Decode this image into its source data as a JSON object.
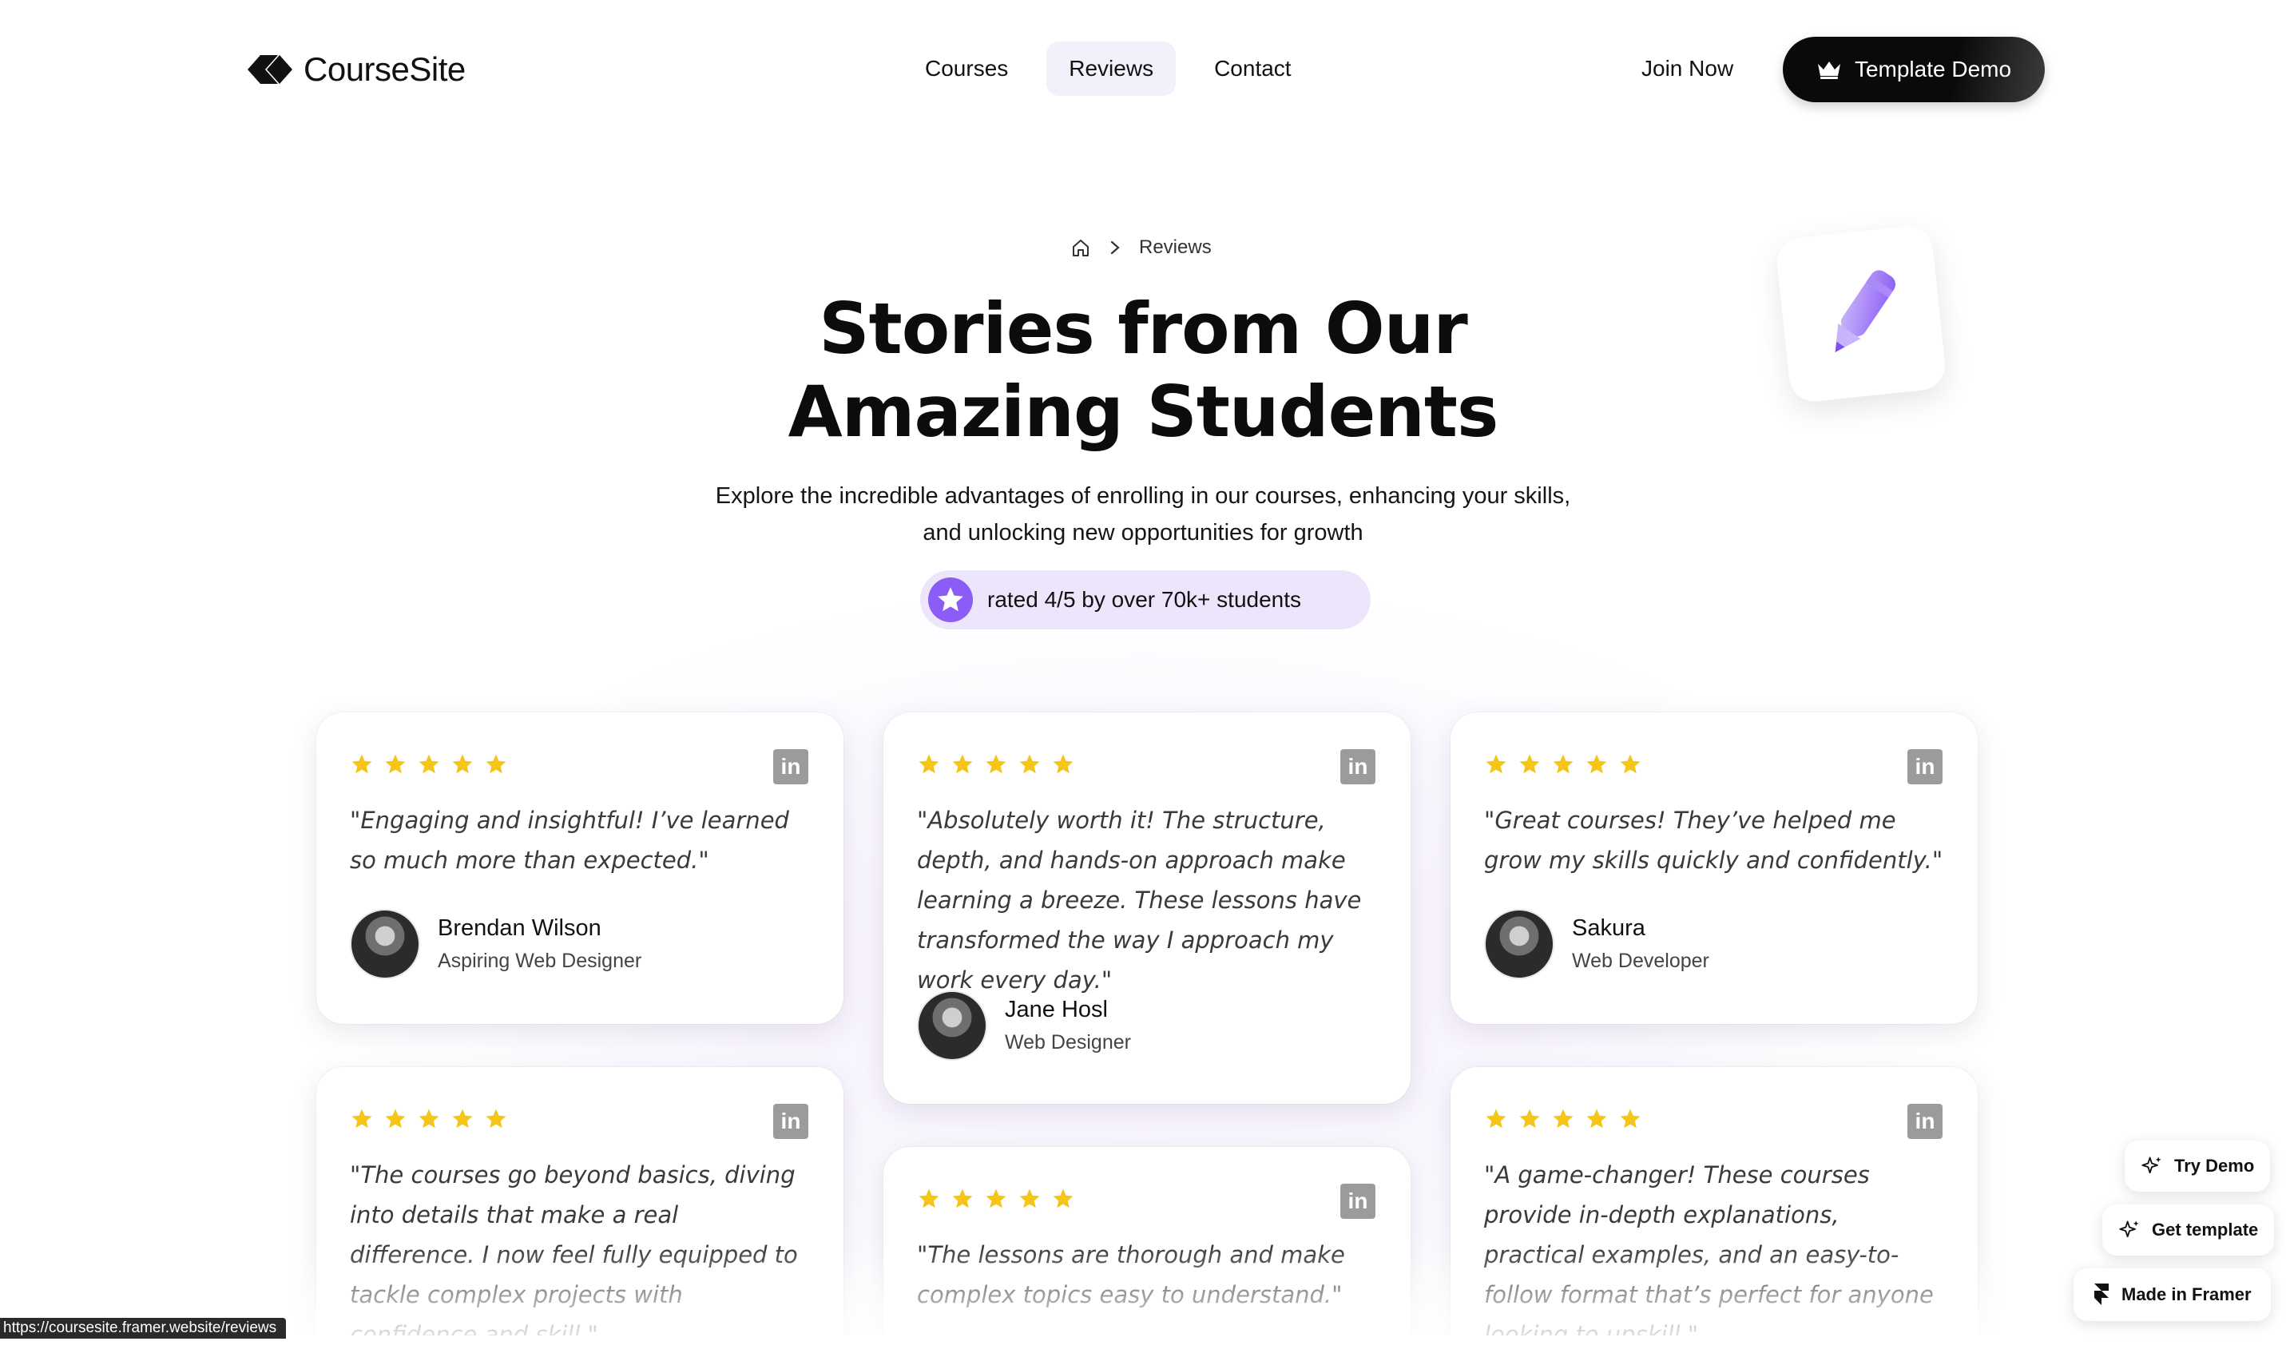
{
  "nav": {
    "brand": "CourseSite",
    "links": [
      {
        "label": "Courses",
        "active": false
      },
      {
        "label": "Reviews",
        "active": true
      },
      {
        "label": "Contact",
        "active": false
      }
    ],
    "join_label": "Join Now",
    "demo_label": "Template Demo"
  },
  "hero": {
    "breadcrumb_current": "Reviews",
    "title_line1": "Stories from Our",
    "title_line2": "Amazing Students",
    "subtitle_line1": "Explore the incredible advantages of enrolling in our courses, enhancing your skills,",
    "subtitle_line2": "and unlocking new opportunities for growth",
    "rating_text": "rated 4/5 by over 70k+ students"
  },
  "colors": {
    "accent": "#8b5cf6",
    "star": "#f5c518",
    "pill_bg": "#ece5fb"
  },
  "reviews": [
    {
      "rating": 5,
      "quote": "\"Engaging and insightful! I’ve learned so much more than expected.\"",
      "name": "Brendan Wilson",
      "role": "Aspiring Web Designer"
    },
    {
      "rating": 5,
      "quote": "\"Absolutely worth it! The structure, depth, and hands-on approach make learning a breeze. These lessons have transformed the way I approach my work every day.\"",
      "name": "Jane Hosl",
      "role": "Web Designer"
    },
    {
      "rating": 5,
      "quote": "\"Great courses! They’ve helped me grow my skills quickly and confidently.\"",
      "name": "Sakura",
      "role": "Web Developer"
    },
    {
      "rating": 5,
      "quote": "\"The courses go beyond basics, diving into details that make a real difference. I now feel fully equipped to tackle complex projects with confidence and skill.\""
    },
    {
      "rating": 5,
      "quote": "\"The lessons are thorough and make complex topics easy to understand.\""
    },
    {
      "rating": 5,
      "quote": "\"A game-changer! These courses provide in-depth explanations, practical examples, and an easy-to-follow format that’s perfect for anyone looking to upskill.\""
    }
  ],
  "social_icon_text": "in",
  "floating": {
    "try_demo": "Try Demo",
    "get_template": "Get template",
    "made_in": "Made in Framer"
  },
  "status_url": "https://coursesite.framer.website/reviews"
}
